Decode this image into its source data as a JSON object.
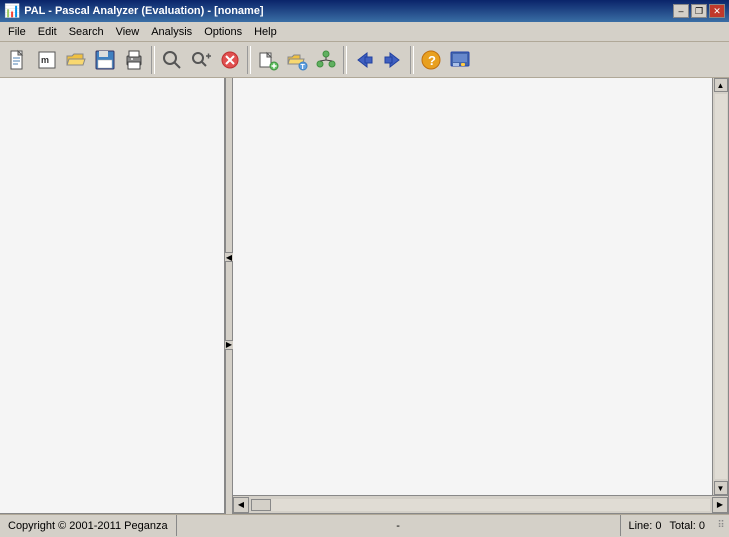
{
  "titlebar": {
    "text": "PAL - Pascal Analyzer (Evaluation)  - [noname]",
    "btn_minimize": "–",
    "btn_restore": "❐",
    "btn_close": "✕"
  },
  "menubar": {
    "items": [
      {
        "label": "File"
      },
      {
        "label": "Edit"
      },
      {
        "label": "Search"
      },
      {
        "label": "View"
      },
      {
        "label": "Analysis"
      },
      {
        "label": "Options"
      },
      {
        "label": "Help"
      }
    ]
  },
  "toolbar": {
    "buttons": [
      {
        "name": "new-btn",
        "icon": "📄"
      },
      {
        "name": "open-memo-btn",
        "icon": "M"
      },
      {
        "name": "open-btn",
        "icon": "📂"
      },
      {
        "name": "save-btn",
        "icon": "💾"
      },
      {
        "name": "print-btn",
        "icon": "🖨"
      },
      {
        "name": "find-btn",
        "icon": "🔍"
      },
      {
        "name": "find-next-btn",
        "icon": "🔍"
      },
      {
        "name": "cancel-btn",
        "icon": "✕"
      },
      {
        "name": "add-file-btn",
        "icon": "📋"
      },
      {
        "name": "project-btn",
        "icon": "🗂"
      },
      {
        "name": "tree-btn",
        "icon": "🌳"
      },
      {
        "name": "info-btn",
        "icon": "ℹ"
      },
      {
        "name": "back-btn",
        "icon": "←"
      },
      {
        "name": "forward-btn",
        "icon": "→"
      },
      {
        "name": "help-btn",
        "icon": "?"
      },
      {
        "name": "about-btn",
        "icon": "📖"
      }
    ]
  },
  "statusbar": {
    "copyright": "Copyright © 2001-2011 Peganza",
    "center": "-",
    "line_label": "Line: 0",
    "total_label": "Total: 0"
  }
}
